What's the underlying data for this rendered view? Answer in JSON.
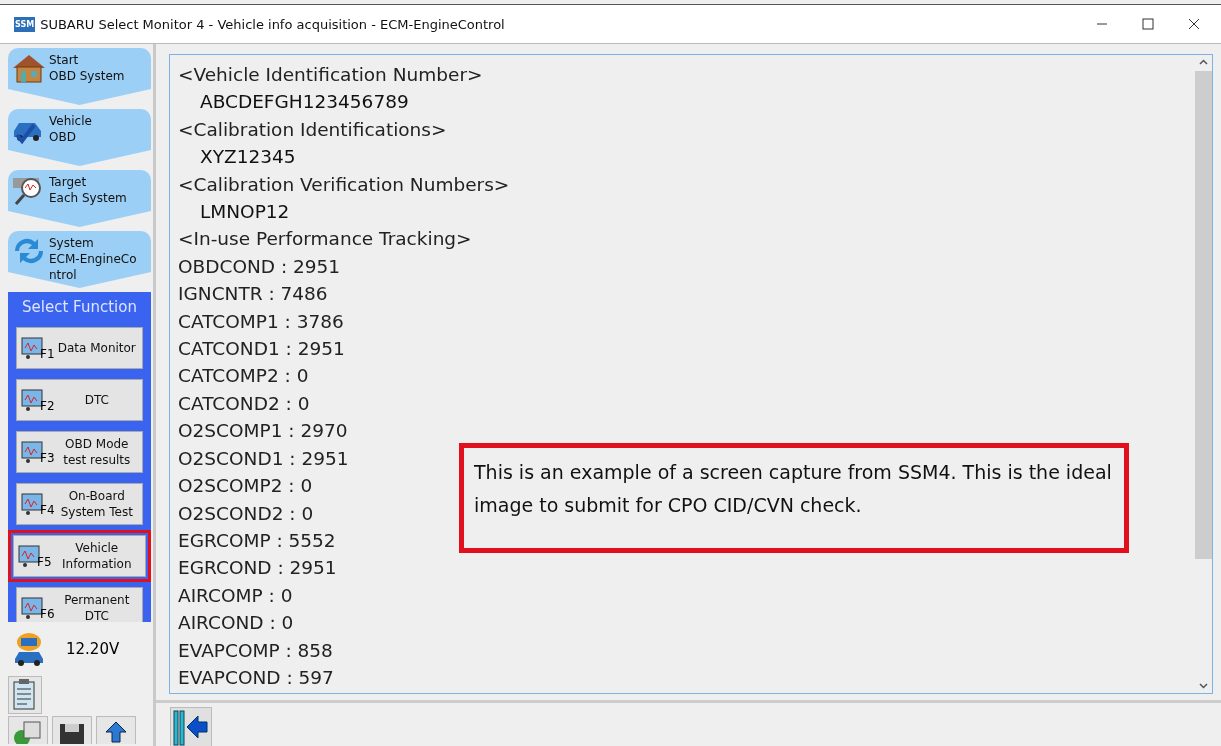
{
  "window": {
    "title": "SUBARU Select Monitor 4 - Vehicle info acquisition - ECM-EngineControl",
    "app_badge": "SSM"
  },
  "nav": [
    {
      "lines": [
        "Start",
        "OBD System"
      ]
    },
    {
      "lines": [
        "Vehicle",
        "OBD"
      ]
    },
    {
      "lines": [
        "Target",
        "Each System"
      ]
    },
    {
      "lines": [
        "System",
        "ECM-EngineCo",
        "ntrol"
      ]
    }
  ],
  "functions": {
    "title": "Select Function",
    "buttons": [
      {
        "key": "F1",
        "lines": [
          "Data Monitor"
        ],
        "selected": false
      },
      {
        "key": "F2",
        "lines": [
          "DTC"
        ],
        "selected": false
      },
      {
        "key": "F3",
        "lines": [
          "OBD Mode",
          "test results"
        ],
        "selected": false
      },
      {
        "key": "F4",
        "lines": [
          "On-Board",
          "System Test"
        ],
        "selected": false
      },
      {
        "key": "F5",
        "lines": [
          "Vehicle",
          "Information"
        ],
        "selected": true
      },
      {
        "key": "F6",
        "lines": [
          "Permanent",
          "DTC"
        ],
        "selected": false
      }
    ]
  },
  "voltage": "12.20V",
  "report": [
    {
      "kind": "heading",
      "text": "<Vehicle Identification Number>"
    },
    {
      "kind": "value",
      "text": "ABCDEFGH123456789"
    },
    {
      "kind": "heading",
      "text": "<Calibration Identifications>"
    },
    {
      "kind": "value",
      "text": "XYZ12345"
    },
    {
      "kind": "heading",
      "text": "<Calibration Verification Numbers>"
    },
    {
      "kind": "value",
      "text": "LMNOP12"
    },
    {
      "kind": "heading",
      "text": "<In-use Performance Tracking>"
    },
    {
      "kind": "entry",
      "text": "OBDCOND : 2951"
    },
    {
      "kind": "entry",
      "text": "IGNCNTR : 7486"
    },
    {
      "kind": "entry",
      "text": "CATCOMP1 : 3786"
    },
    {
      "kind": "entry",
      "text": "CATCOND1 : 2951"
    },
    {
      "kind": "entry",
      "text": "CATCOMP2 : 0"
    },
    {
      "kind": "entry",
      "text": "CATCOND2 : 0"
    },
    {
      "kind": "entry",
      "text": "O2SCOMP1 : 2970"
    },
    {
      "kind": "entry",
      "text": "O2SCOND1 : 2951"
    },
    {
      "kind": "entry",
      "text": "O2SCOMP2 : 0"
    },
    {
      "kind": "entry",
      "text": "O2SCOND2 : 0"
    },
    {
      "kind": "entry",
      "text": "EGRCOMP : 5552"
    },
    {
      "kind": "entry",
      "text": "EGRCOND : 2951"
    },
    {
      "kind": "entry",
      "text": "AIRCOMP : 0"
    },
    {
      "kind": "entry",
      "text": "AIRCOND : 0"
    },
    {
      "kind": "entry",
      "text": "EVAPCOMP : 858"
    },
    {
      "kind": "entry",
      "text": "EVAPCOND : 597"
    }
  ],
  "callout": "This is an example of a screen capture from SSM4. This is the ideal image to submit for CPO CID/CVN check."
}
